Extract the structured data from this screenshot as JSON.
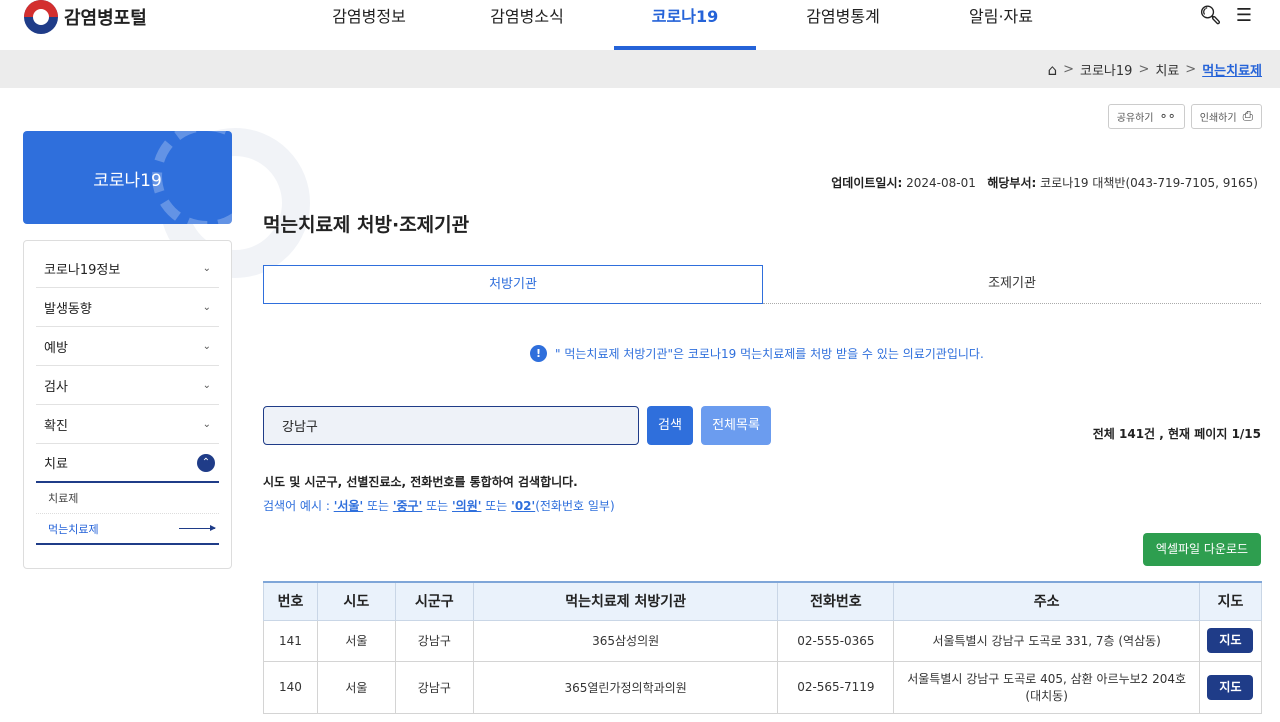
{
  "header": {
    "logo_text": "감염병포털",
    "nav": [
      {
        "label": "감염병정보"
      },
      {
        "label": "감염병소식"
      },
      {
        "label": "코로나19"
      },
      {
        "label": "감염병통계"
      },
      {
        "label": "알림·자료"
      }
    ],
    "active_nav": "코로나19"
  },
  "breadcrumb": [
    "코로나19",
    "치료",
    "먹는치료제"
  ],
  "tools": {
    "share_label": "공유하기",
    "print_label": "인쇄하기"
  },
  "sidebar": {
    "title": "코로나19",
    "items": [
      {
        "label": "코로나19정보"
      },
      {
        "label": "발생동향"
      },
      {
        "label": "예방"
      },
      {
        "label": "검사"
      },
      {
        "label": "확진"
      },
      {
        "label": "치료"
      }
    ],
    "subitems": [
      {
        "label": "치료제"
      },
      {
        "label": "먹는치료제"
      }
    ]
  },
  "update": {
    "label": "업데이트일시:",
    "date": "2024-08-01",
    "dept_label": "해당부서:",
    "dept": "코로나19 대책반(043-719-7105, 9165)"
  },
  "page_title": "먹는치료제 처방·조제기관",
  "tabs": [
    {
      "label": "처방기관"
    },
    {
      "label": "조제기관"
    }
  ],
  "notice": "\" 먹는치료제 처방기관\"은 코로나19 먹는치료제를 처방 받을 수 있는 의료기관입니다.",
  "search": {
    "value": "강남구",
    "search_label": "검색",
    "all_label": "전체목록",
    "count_text": "전체 141건 ,  현재 페이지 1/15",
    "hint": "시도 및 시군구, 선별진료소, 전화번호를 통합하여 검색합니다.",
    "example_prefix": "검색어 예시 : ",
    "examples": [
      "'서울'",
      "'중구'",
      "'의원'",
      "'02'"
    ],
    "or_word": " 또는 ",
    "example_suffix": "(전화번호 일부)"
  },
  "excel_label": "엑셀파일 다운로드",
  "table": {
    "headers": [
      "번호",
      "시도",
      "시군구",
      "먹는치료제 처방기관",
      "전화번호",
      "주소",
      "지도"
    ],
    "rows": [
      {
        "no": "141",
        "sido": "서울",
        "sigungu": "강남구",
        "name": "365삼성의원",
        "phone": "02-555-0365",
        "address": "서울특별시 강남구 도곡로 331, 7층 (역삼동)",
        "map": "지도"
      },
      {
        "no": "140",
        "sido": "서울",
        "sigungu": "강남구",
        "name": "365열린가정의학과의원",
        "phone": "02-565-7119",
        "address": "서울특별시 강남구 도곡로 405, 삼환 아르누보2 204호 (대치동)",
        "map": "지도"
      }
    ]
  }
}
